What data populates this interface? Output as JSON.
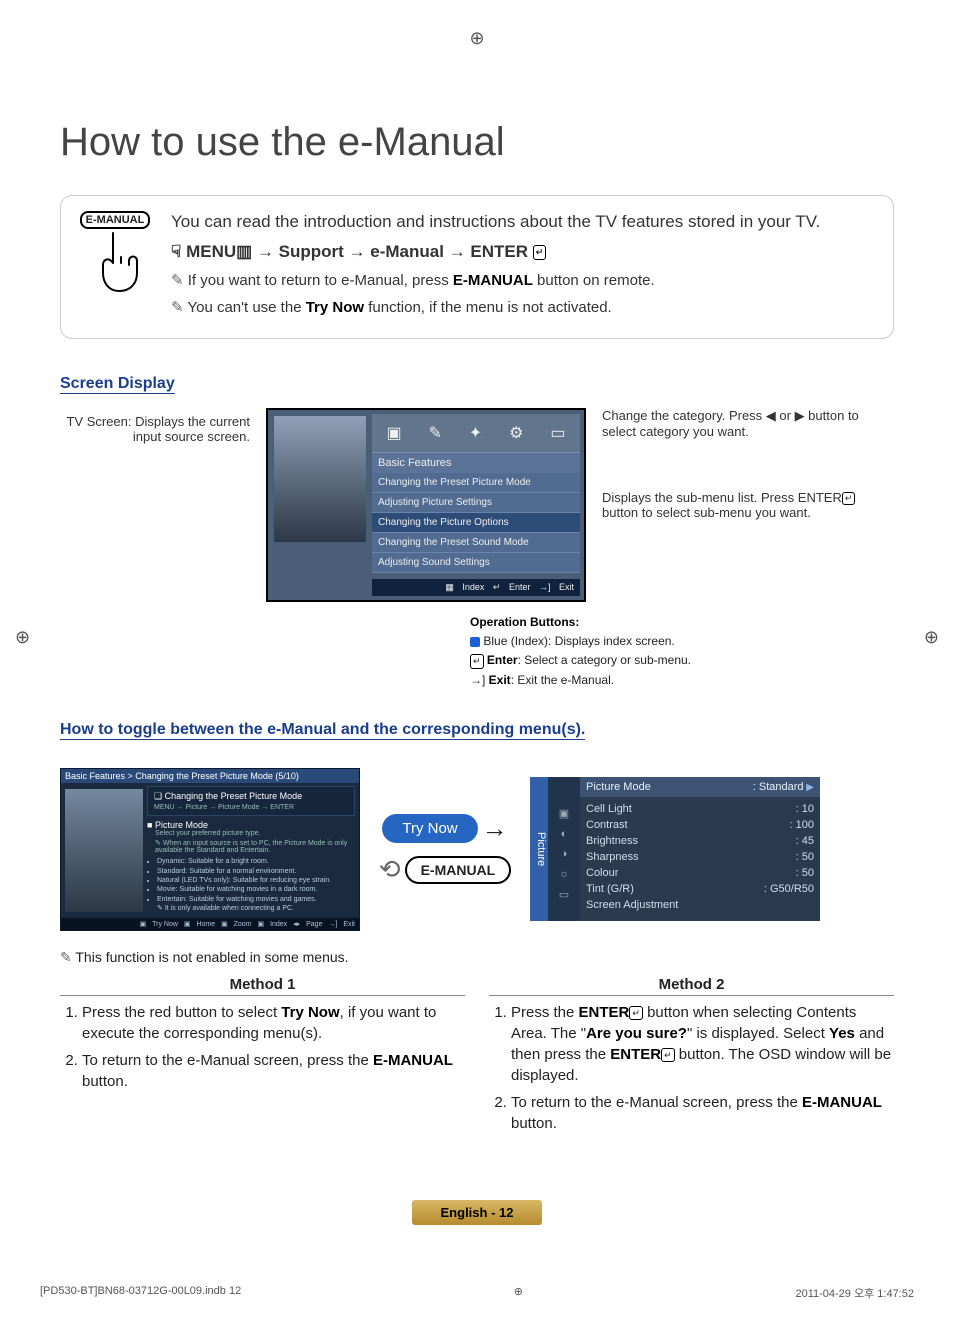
{
  "title": "How to use the e-Manual",
  "intro": {
    "remote_button_label": "E-MANUAL",
    "lead_text": "You can read the introduction and instructions about the TV features stored in your TV.",
    "nav_prefix": "MENU",
    "nav_step2": "Support",
    "nav_step3": "e-Manual",
    "nav_step4": "ENTER",
    "note1_pre": "If you want to return to e-Manual, press ",
    "note1_bold": "E-MANUAL",
    "note1_post": " button on remote.",
    "note2_pre": "You can't use the ",
    "note2_bold": "Try Now",
    "note2_post": " function, if the menu is not activated."
  },
  "screen_display": {
    "header": "Screen Display",
    "left_caption": "TV Screen: Displays the current input source screen.",
    "category_label": "Basic Features",
    "menu_items": [
      "Changing the Preset Picture Mode",
      "Adjusting Picture Settings",
      "Changing the Picture Options",
      "Changing the Preset Sound Mode",
      "Adjusting Sound Settings"
    ],
    "ops_index": "Index",
    "ops_enter": "Enter",
    "ops_exit": "Exit",
    "right_top": "Change the category. Press ◀ or ▶ button to select category you want.",
    "right_mid": "Displays the sub-menu list. Press ENTER",
    "right_mid_post": " button to select sub-menu you want.",
    "operation_heading": "Operation Buttons:",
    "op_blue": "Blue (Index): Displays index screen.",
    "op_enter_label": "Enter",
    "op_enter_text": ": Select a category or sub-menu.",
    "op_exit_label": "Exit",
    "op_exit_text": ": Exit the e-Manual."
  },
  "toggle": {
    "header": "How to toggle between the e-Manual and the corresponding menu(s).",
    "breadcrumb": "Basic Features > Changing the Preset Picture Mode (5/10)",
    "pm_h1": "Changing the Preset Picture Mode",
    "pm_nav": "MENU → Picture → Picture Mode → ENTER",
    "pm_h2": "Picture Mode",
    "pm_sub": "Select your preferred picture type.",
    "pm_note": "When an input source is set to PC, the Picture Mode is only available the Standard and Entertain.",
    "bullet_dynamic": "Dynamic: Suitable for a bright room.",
    "bullet_standard": "Standard: Suitable for a normal environment.",
    "bullet_natural": "Natural (LED TVs only): Suitable for reducing eye strain.",
    "bullet_movie": "Movie: Suitable for watching movies in a dark room.",
    "bullet_entertain": "Entertain: Suitable for watching movies and games.",
    "bullet_entertain_note": "It is only available when connecting a PC.",
    "ftr_trynow": "Try Now",
    "ftr_home": "Home",
    "ftr_zoom": "Zoom",
    "ftr_index": "Index",
    "ftr_page": "Page",
    "ftr_exit": "Exit",
    "trynow_pill": "Try Now",
    "emanual_pill": "E-MANUAL",
    "picture_tab": "Picture",
    "picture_mode_label": "Picture Mode",
    "picture_mode_value": "Standard",
    "rows": [
      {
        "l": "Cell Light",
        "v": ": 10"
      },
      {
        "l": "Contrast",
        "v": ": 100"
      },
      {
        "l": "Brightness",
        "v": ": 45"
      },
      {
        "l": "Sharpness",
        "v": ": 50"
      },
      {
        "l": "Colour",
        "v": ": 50"
      },
      {
        "l": "Tint (G/R)",
        "v": ": G50/R50"
      },
      {
        "l": "Screen Adjustment",
        "v": ""
      }
    ]
  },
  "methods": {
    "note": "This function is not enabled in some menus.",
    "m1_title": "Method 1",
    "m1_1_pre": "Press the red button to select ",
    "m1_1_bold": "Try Now",
    "m1_1_post": ", if you want to execute the corresponding menu(s).",
    "m1_2_pre": "To return to the e-Manual screen, press the ",
    "m1_2_bold": "E-MANUAL",
    "m1_2_post": " button.",
    "m2_title": "Method 2",
    "m2_1_pre": "Press the ",
    "m2_1_bold1": "ENTER",
    "m2_1_mid1": " button when selecting Contents Area. The \"",
    "m2_1_bold2": "Are you sure?",
    "m2_1_mid2": "\" is displayed. Select ",
    "m2_1_bold3": "Yes",
    "m2_1_mid3": " and then press the ",
    "m2_1_bold4": "ENTER",
    "m2_1_post": " button. The OSD window will be displayed.",
    "m2_2_pre": "To return to the e-Manual screen, press the ",
    "m2_2_bold": "E-MANUAL",
    "m2_2_post": " button."
  },
  "footer": {
    "badge": "English - 12",
    "left": "[PD530-BT]BN68-03712G-00L09.indb   12",
    "right": "2011-04-29   오후 1:47:52"
  }
}
